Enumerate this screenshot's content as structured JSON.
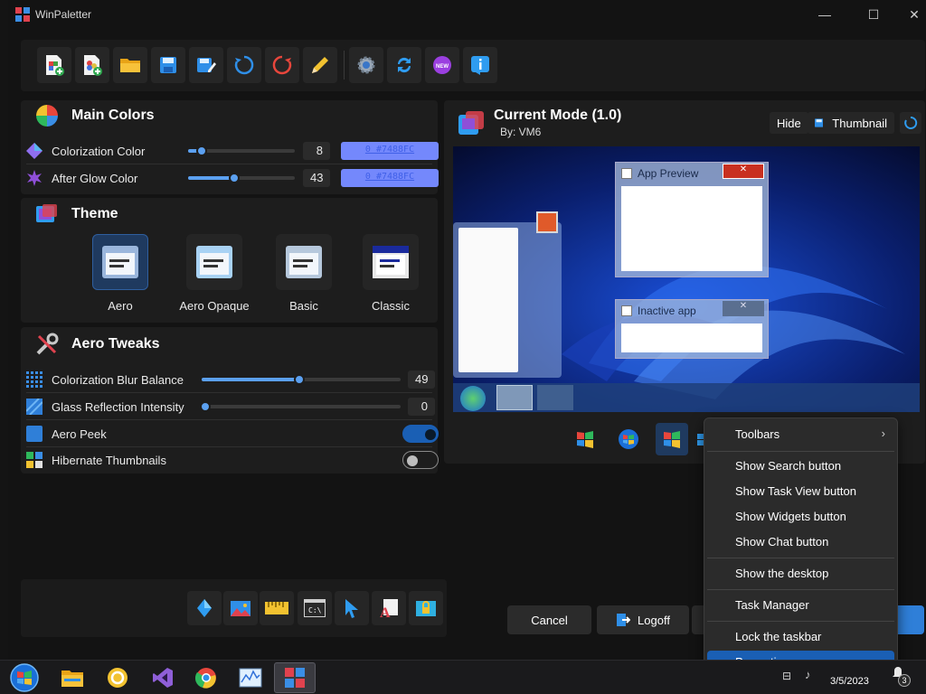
{
  "window": {
    "title": "WinPaletter",
    "minimize": "—",
    "maximize": "☐",
    "close": "✕"
  },
  "toolbar": [
    {
      "name": "new-file-icon"
    },
    {
      "name": "new-from-template-icon"
    },
    {
      "name": "open-folder-icon"
    },
    {
      "name": "save-icon"
    },
    {
      "name": "save-as-icon"
    },
    {
      "name": "refresh-icon"
    },
    {
      "name": "restore-icon"
    },
    {
      "name": "edit-pencil-icon"
    },
    {
      "name": "settings-gear-icon"
    },
    {
      "name": "sync-icon"
    },
    {
      "name": "whats-new-icon",
      "label": "NEW"
    },
    {
      "name": "about-info-icon"
    }
  ],
  "main_colors": {
    "title": "Main Colors",
    "colorization": {
      "label": "Colorization Color",
      "value": "8",
      "hex": "0 #7488FC",
      "level": 0.08
    },
    "afterglow": {
      "label": "After Glow Color",
      "value": "43",
      "hex": "0 #7488FC",
      "level": 0.43
    }
  },
  "theme": {
    "title": "Theme",
    "options": [
      {
        "label": "Aero",
        "selected": true
      },
      {
        "label": "Aero Opaque",
        "selected": false
      },
      {
        "label": "Basic",
        "selected": false
      },
      {
        "label": "Classic",
        "selected": false
      }
    ]
  },
  "aero_tweaks": {
    "title": "Aero Tweaks",
    "blur": {
      "label": "Colorization Blur Balance",
      "value": "49",
      "level": 0.49
    },
    "reflection": {
      "label": "Glass Reflection Intensity",
      "value": "0",
      "level": 0.0
    },
    "peek": {
      "label": "Aero Peek",
      "on": true
    },
    "hibernate": {
      "label": "Hibernate Thumbnails",
      "on": false
    }
  },
  "preview": {
    "title": "Current Mode (1.0)",
    "author": "By: VM6",
    "hide_label": "Hide",
    "thumbnail_label": "Thumbnail",
    "app_preview_title": "App Preview",
    "inactive_app_title": "Inactive app"
  },
  "actions": {
    "cancel": "Cancel",
    "logoff": "Logoff"
  },
  "context_menu": {
    "toolbars": "Toolbars",
    "show_search": "Show Search button",
    "show_taskview": "Show Task View button",
    "show_widgets": "Show Widgets button",
    "show_chat": "Show Chat button",
    "show_desktop": "Show the desktop",
    "task_manager": "Task Manager",
    "lock_taskbar": "Lock the taskbar",
    "properties": "Properties"
  },
  "taskbar": {
    "date": "3/5/2023",
    "badge": "3"
  },
  "colors": {
    "accent": "#5ba0f0",
    "colorization": "#7488FC",
    "selected_menu": "#1a5fb4"
  }
}
